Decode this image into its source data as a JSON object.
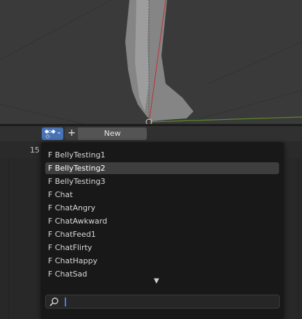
{
  "header": {
    "new_label": "New",
    "plus_label": "+"
  },
  "timeline": {
    "frame_label": "15"
  },
  "dropdown": {
    "items": [
      {
        "label": "F BellyTesting1",
        "active": false
      },
      {
        "label": "F BellyTesting2",
        "active": true
      },
      {
        "label": "F BellyTesting3",
        "active": false
      },
      {
        "label": "F Chat",
        "active": false
      },
      {
        "label": "F ChatAngry",
        "active": false
      },
      {
        "label": "F ChatAwkward",
        "active": false
      },
      {
        "label": "F ChatFeed1",
        "active": false
      },
      {
        "label": "F ChatFlirty",
        "active": false
      },
      {
        "label": "F ChatHappy",
        "active": false
      },
      {
        "label": "F ChatSad",
        "active": false
      }
    ],
    "more_indicator": "▼",
    "search": {
      "value": "",
      "placeholder": ""
    }
  },
  "colors": {
    "accent": "#4772b3",
    "highlight": "#3e3e3e",
    "menu_bg": "#181818"
  }
}
